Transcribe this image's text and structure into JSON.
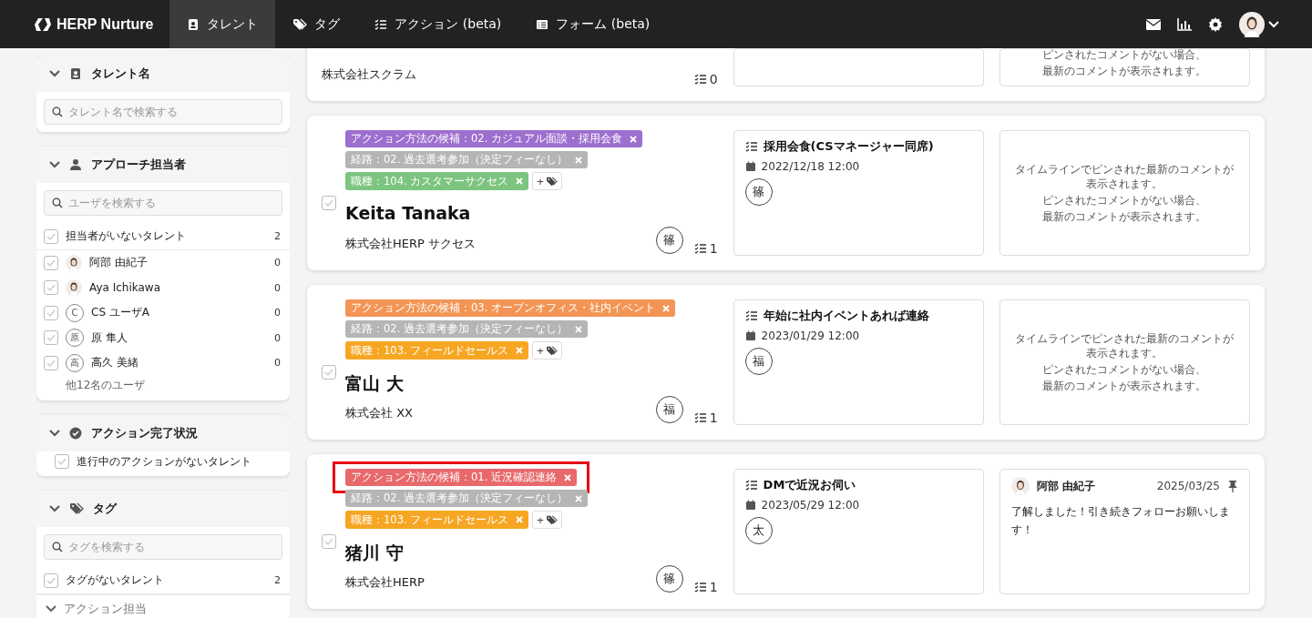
{
  "nav": {
    "brand": "HERP Nurture",
    "tabs": [
      {
        "label": "タレント",
        "selected": true
      },
      {
        "label": "タグ",
        "selected": false
      },
      {
        "label": "アクション (beta)",
        "selected": false
      },
      {
        "label": "フォーム (beta)",
        "selected": false
      }
    ]
  },
  "sidebar": {
    "sections": [
      {
        "title": "タレント名",
        "expanded": true,
        "search": {
          "placeholder": "タレント名で検索する"
        }
      },
      {
        "title": "アプローチ担当者",
        "expanded": true,
        "search": {
          "placeholder": "ユーザを検索する"
        },
        "none_option": {
          "label": "担当者がいないタレント",
          "count": "2",
          "checked": false
        },
        "users": [
          {
            "name": "阿部 由紀子",
            "count": "0",
            "checked": false,
            "kind": "photo"
          },
          {
            "name": "Aya Ichikawa",
            "count": "0",
            "checked": false,
            "kind": "photo"
          },
          {
            "name": "CS ユーザA",
            "count": "0",
            "checked": false,
            "kind": "initial",
            "initial": "C"
          },
          {
            "name": "原 隼人",
            "count": "0",
            "checked": false,
            "kind": "initial",
            "initial": "原"
          },
          {
            "name": "高久 美緒",
            "count": "0",
            "checked": false,
            "kind": "initial",
            "initial": "高"
          }
        ],
        "more": "他12名のユーザ"
      },
      {
        "title": "アクション完了状況",
        "expanded": true,
        "options": [
          {
            "label": "進行中のアクションがないタレント",
            "checked": false
          }
        ]
      },
      {
        "title": "タグ",
        "expanded": true,
        "search": {
          "placeholder": "タグを検索する"
        },
        "none_option": {
          "label": "タグがないタレント",
          "count": "2",
          "checked": false
        },
        "groups": [
          {
            "label": "アクション担当",
            "expanded": true
          }
        ]
      }
    ]
  },
  "talents": [
    {
      "cut_off": true,
      "company": "株式会社スクラム",
      "action_count": "0",
      "comment": {
        "kind": "empty",
        "lines": [
          "ピンされたコメントがない場合、",
          "最新のコメントが表示されます。"
        ]
      }
    },
    {
      "selected": false,
      "tags": [
        {
          "text": "アクション方法の候補：02. カジュアル面談・採用会食",
          "color": "#9d6fcf",
          "highlighted": false
        },
        {
          "text": "経路：02. 過去選考参加（決定フィーなし）",
          "color": "#b5b5b5",
          "highlighted": false
        },
        {
          "text": "職種：104. カスタマーサクセス",
          "color": "#7cc47f",
          "highlighted": false
        }
      ],
      "add_tag": "+",
      "name": "Keita Tanaka",
      "company": "株式会社HERP サクセス",
      "owner": "篠",
      "action_count": "1",
      "action": {
        "title": "採用会食(CSマネージャー同席)",
        "date": "2022/12/18 12:00",
        "assignee": "篠"
      },
      "comment": {
        "kind": "empty",
        "lines": [
          "タイムラインでピンされた最新のコメントが表示されます。",
          "ピンされたコメントがない場合、",
          "最新のコメントが表示されます。"
        ]
      }
    },
    {
      "selected": false,
      "tags": [
        {
          "text": "アクション方法の候補：03. オープンオフィス・社内イベント",
          "color": "#f39555",
          "highlighted": false
        },
        {
          "text": "経路：02. 過去選考参加（決定フィーなし）",
          "color": "#b5b5b5",
          "highlighted": false
        },
        {
          "text": "職種：103. フィールドセールス",
          "color": "#f7a623",
          "highlighted": false
        }
      ],
      "add_tag": "+",
      "name": "富山 大",
      "company": "株式会社 XX",
      "owner": "福",
      "action_count": "1",
      "action": {
        "title": "年始に社内イベントあれば連絡",
        "date": "2023/01/29 12:00",
        "assignee": "福"
      },
      "comment": {
        "kind": "empty",
        "lines": [
          "タイムラインでピンされた最新のコメントが表示されます。",
          "ピンされたコメントがない場合、",
          "最新のコメントが表示されます。"
        ]
      }
    },
    {
      "selected": false,
      "tags": [
        {
          "text": "アクション方法の候補：01. 近況確認連絡",
          "color": "#e8696c",
          "highlighted": true
        },
        {
          "text": "経路：02. 過去選考参加（決定フィーなし）",
          "color": "#b5b5b5",
          "highlighted": false
        },
        {
          "text": "職種：103. フィールドセールス",
          "color": "#f7a623",
          "highlighted": false
        }
      ],
      "add_tag": "+",
      "name": "猪川 守",
      "company": "株式会社HERP",
      "owner": "篠",
      "action_count": "1",
      "action": {
        "title": "DMで近況お伺い",
        "date": "2023/05/29 12:00",
        "assignee": "太"
      },
      "comment": {
        "kind": "comment",
        "author": "阿部 由紀子",
        "date": "2025/03/25",
        "pinned": true,
        "text": "了解しました！引き続きフォローお願いします！"
      }
    }
  ]
}
